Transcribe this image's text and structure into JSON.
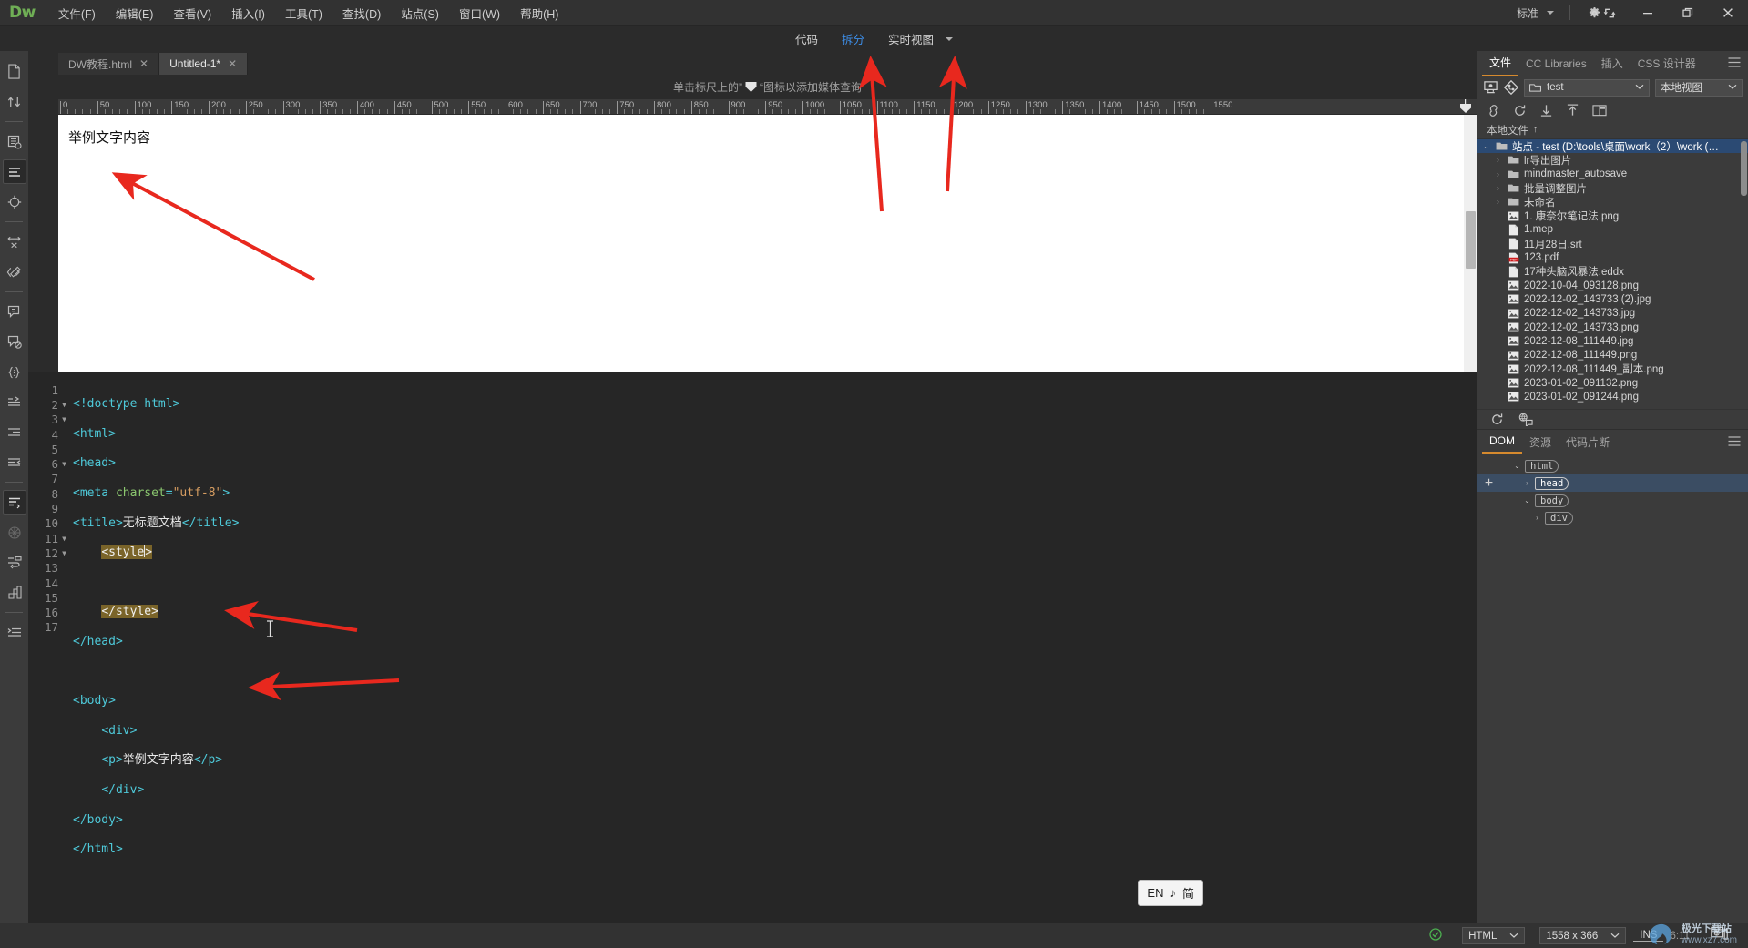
{
  "app": {
    "logo": "Dw",
    "menus": [
      "文件(F)",
      "编辑(E)",
      "查看(V)",
      "插入(I)",
      "工具(T)",
      "查找(D)",
      "站点(S)",
      "窗口(W)",
      "帮助(H)"
    ],
    "workspace": "标准",
    "window_controls": {
      "minimize": "—",
      "maximize": "❐",
      "close": "✕"
    }
  },
  "viewbar": {
    "code": "代码",
    "split": "拆分",
    "live": "实时视图"
  },
  "doc_tabs": [
    {
      "label": "DW教程.html",
      "active": false,
      "close": "✕"
    },
    {
      "label": "Untitled-1*",
      "active": true,
      "close": "✕"
    }
  ],
  "design": {
    "mq_hint_before": "单击标尺上的”",
    "mq_hint_icon": "▼",
    "mq_hint_after": "“图标以添加媒体查询",
    "ruler_start": 0,
    "ruler_step": 50,
    "ruler_max": 1550,
    "paragraph": "举例文字内容"
  },
  "code": {
    "lines": [
      {
        "n": 1,
        "fold": "",
        "indent": 0
      },
      {
        "n": 2,
        "fold": "▼",
        "indent": 0
      },
      {
        "n": 3,
        "fold": "▼",
        "indent": 0
      },
      {
        "n": 4,
        "fold": "",
        "indent": 0
      },
      {
        "n": 5,
        "fold": "",
        "indent": 0
      },
      {
        "n": 6,
        "fold": "▼",
        "indent": 1
      },
      {
        "n": 7,
        "fold": "",
        "indent": 0
      },
      {
        "n": 8,
        "fold": "",
        "indent": 1
      },
      {
        "n": 9,
        "fold": "",
        "indent": 0
      },
      {
        "n": 10,
        "fold": "",
        "indent": 0
      },
      {
        "n": 11,
        "fold": "▼",
        "indent": 0
      },
      {
        "n": 12,
        "fold": "▼",
        "indent": 1
      },
      {
        "n": 13,
        "fold": "",
        "indent": 1
      },
      {
        "n": 14,
        "fold": "",
        "indent": 1
      },
      {
        "n": 15,
        "fold": "",
        "indent": 0
      },
      {
        "n": 16,
        "fold": "",
        "indent": 0
      },
      {
        "n": 17,
        "fold": "",
        "indent": 0
      }
    ],
    "text": {
      "l1": "<!doctype html>",
      "l2": "<html>",
      "l3": "<head>",
      "l4_tag_open": "<meta ",
      "l4_attr": "charset",
      "l4_eq": "=",
      "l4_val": "\"utf-8\"",
      "l4_tag_close": ">",
      "l5_open": "<title>",
      "l5_text": "无标题文档",
      "l5_close": "</title>",
      "l6": "<style>",
      "l8": "</style>",
      "l9": "</head>",
      "l11": "<body>",
      "l12": "<div>",
      "l13_open": "<p>",
      "l13_text": "举例文字内容",
      "l13_close": "</p>",
      "l14": "</div>",
      "l15": "</body>",
      "l16": "</html>"
    },
    "ime": {
      "lang": "EN",
      "note": "♪",
      "mode": "简"
    }
  },
  "right_panel": {
    "tabs": [
      {
        "label": "文件",
        "active": true
      },
      {
        "label": "CC Libraries",
        "active": false
      },
      {
        "label": "插入",
        "active": false
      },
      {
        "label": "CSS 设计器",
        "active": false
      }
    ],
    "site_select": "test",
    "view_select": "本地视图",
    "column_header": "本地文件",
    "files": [
      {
        "label": "站点 - test (D:\\tools\\桌面\\work（2）\\work (…",
        "type": "folder-open",
        "depth": 0,
        "arrow": "⌄",
        "selected": true
      },
      {
        "label": "lr导出图片",
        "type": "folder",
        "depth": 1,
        "arrow": "›",
        "selected": false
      },
      {
        "label": "mindmaster_autosave",
        "type": "folder",
        "depth": 1,
        "arrow": "›",
        "selected": false
      },
      {
        "label": "批量调整图片",
        "type": "folder",
        "depth": 1,
        "arrow": "›",
        "selected": false
      },
      {
        "label": "未命名",
        "type": "folder",
        "depth": 1,
        "arrow": "›",
        "selected": false
      },
      {
        "label": "1. 康奈尔笔记法.png",
        "type": "image",
        "depth": 1,
        "arrow": "",
        "selected": false
      },
      {
        "label": "1.mep",
        "type": "file",
        "depth": 1,
        "arrow": "",
        "selected": false
      },
      {
        "label": "11月28日.srt",
        "type": "file",
        "depth": 1,
        "arrow": "",
        "selected": false
      },
      {
        "label": "123.pdf",
        "type": "pdf",
        "depth": 1,
        "arrow": "",
        "selected": false
      },
      {
        "label": "17种头脑风暴法.eddx",
        "type": "file",
        "depth": 1,
        "arrow": "",
        "selected": false
      },
      {
        "label": "2022-10-04_093128.png",
        "type": "image",
        "depth": 1,
        "arrow": "",
        "selected": false
      },
      {
        "label": "2022-12-02_143733 (2).jpg",
        "type": "image",
        "depth": 1,
        "arrow": "",
        "selected": false
      },
      {
        "label": "2022-12-02_143733.jpg",
        "type": "image",
        "depth": 1,
        "arrow": "",
        "selected": false
      },
      {
        "label": "2022-12-02_143733.png",
        "type": "image",
        "depth": 1,
        "arrow": "",
        "selected": false
      },
      {
        "label": "2022-12-08_111449.jpg",
        "type": "image",
        "depth": 1,
        "arrow": "",
        "selected": false
      },
      {
        "label": "2022-12-08_111449.png",
        "type": "image",
        "depth": 1,
        "arrow": "",
        "selected": false
      },
      {
        "label": "2022-12-08_111449_副本.png",
        "type": "image",
        "depth": 1,
        "arrow": "",
        "selected": false
      },
      {
        "label": "2023-01-02_091132.png",
        "type": "image",
        "depth": 1,
        "arrow": "",
        "selected": false
      },
      {
        "label": "2023-01-02_091244.png",
        "type": "image",
        "depth": 1,
        "arrow": "",
        "selected": false
      }
    ],
    "dom_tabs": [
      {
        "label": "DOM",
        "active": true
      },
      {
        "label": "资源",
        "active": false
      },
      {
        "label": "代码片断",
        "active": false
      }
    ],
    "dom_nodes": [
      {
        "tag": "html",
        "depth": 1,
        "arrow": "⌄",
        "selected": false
      },
      {
        "tag": "head",
        "depth": 2,
        "arrow": "›",
        "selected": true
      },
      {
        "tag": "body",
        "depth": 2,
        "arrow": "⌄",
        "selected": false
      },
      {
        "tag": "div",
        "depth": 3,
        "arrow": "›",
        "selected": false
      }
    ]
  },
  "statusbar": {
    "validate": "✓",
    "doctype": "HTML",
    "dimensions": "1558 x 366",
    "ins": "INS",
    "cursor": "6:11"
  },
  "watermark": {
    "title": "极光下载站",
    "url": "www.xz7.com"
  },
  "colors": {
    "accent_blue": "#3d8ee8",
    "tab_underline": "#d68a2e",
    "logo_green": "#6fae55",
    "selection_blue": "#2b4a73",
    "arrow_red": "#e8281e",
    "highlight": "#7a6429"
  }
}
